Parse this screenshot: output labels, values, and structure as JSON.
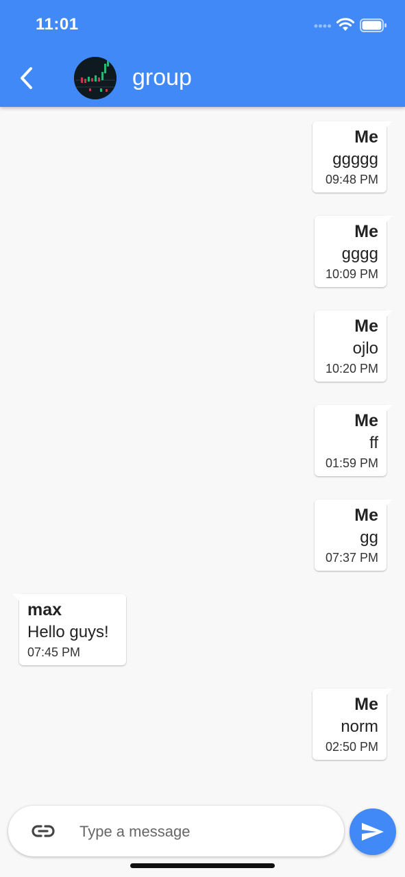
{
  "status_bar": {
    "time": "11:01"
  },
  "header": {
    "title": "group",
    "avatar_icon": "group-avatar-chart-image",
    "back_icon": "chevron-left-icon"
  },
  "messages": [
    {
      "sender": "Me",
      "text": "ggggg",
      "time": "09:48 PM",
      "own": true
    },
    {
      "sender": "Me",
      "text": "gggg",
      "time": "10:09 PM",
      "own": true
    },
    {
      "sender": "Me",
      "text": "ojlo",
      "time": "10:20 PM",
      "own": true
    },
    {
      "sender": "Me",
      "text": "ff",
      "time": "01:59 PM",
      "own": true
    },
    {
      "sender": "Me",
      "text": "gg",
      "time": "07:37 PM",
      "own": true
    },
    {
      "sender": "max",
      "text": "Hello guys!",
      "time": "07:45 PM",
      "own": false
    },
    {
      "sender": "Me",
      "text": "norm",
      "time": "02:50 PM",
      "own": true
    }
  ],
  "composer": {
    "placeholder": "Type a message",
    "attach_icon": "link-icon",
    "send_icon": "send-icon"
  },
  "colors": {
    "primary": "#4089f6",
    "background": "#f8f8f8",
    "bubble": "#ffffff"
  }
}
